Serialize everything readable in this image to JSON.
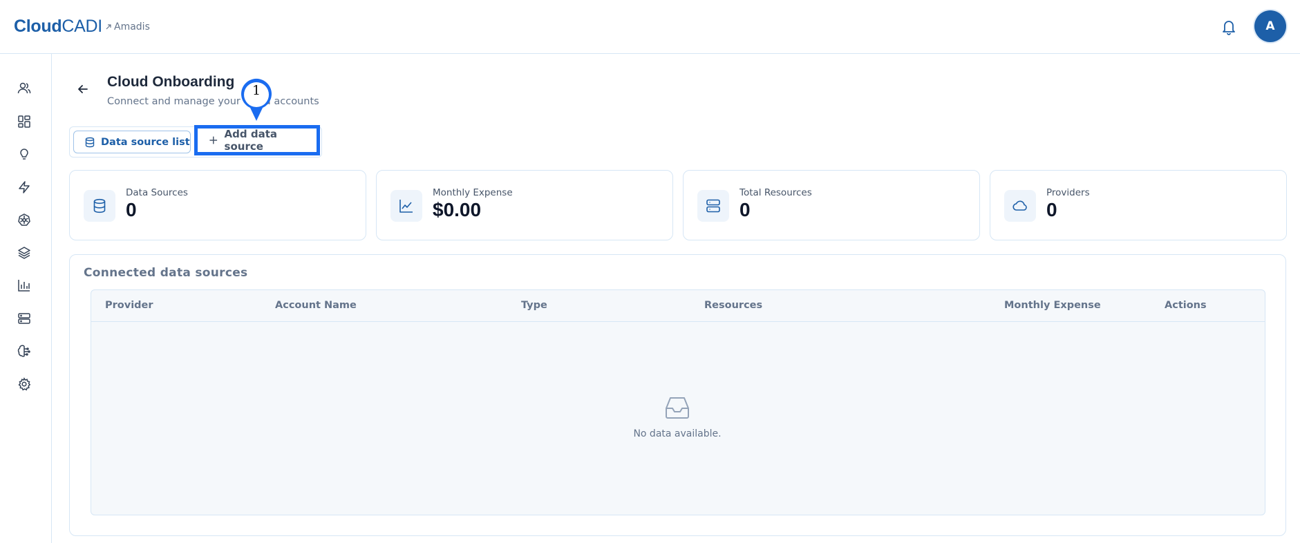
{
  "header": {
    "brand_bold": "Cloud",
    "brand_light": "CADI",
    "org_name": "Amadis",
    "avatar_initial": "A"
  },
  "sidebar": {
    "items": [
      {
        "icon": "users-icon"
      },
      {
        "icon": "dashboard-icon"
      },
      {
        "icon": "lightbulb-icon"
      },
      {
        "icon": "lightning-icon"
      },
      {
        "icon": "kubernetes-icon"
      },
      {
        "icon": "layers-icon"
      },
      {
        "icon": "bar-chart-icon"
      },
      {
        "icon": "server-icon"
      },
      {
        "icon": "brain-icon"
      },
      {
        "icon": "gear-icon"
      }
    ]
  },
  "page": {
    "title": "Cloud Onboarding",
    "subtitle": "Connect and manage your cloud accounts"
  },
  "tabs": {
    "list_label": "Data source list",
    "add_label": "Add data source"
  },
  "marker": {
    "number": "1",
    "color": "#1a6cf0"
  },
  "stats": [
    {
      "label": "Data Sources",
      "value": "0",
      "icon": "database-icon"
    },
    {
      "label": "Monthly Expense",
      "value": "$0.00",
      "icon": "line-chart-icon"
    },
    {
      "label": "Total Resources",
      "value": "0",
      "icon": "server-icon"
    },
    {
      "label": "Providers",
      "value": "0",
      "icon": "cloud-icon"
    }
  ],
  "connected": {
    "title": "Connected data sources",
    "columns": [
      "Provider",
      "Account Name",
      "Type",
      "Resources",
      "Monthly Expense",
      "Actions"
    ],
    "empty_text": "No data available."
  },
  "colors": {
    "brand": "#1d5fa8",
    "border": "#d6e6f5",
    "highlight": "#1a6cf0"
  }
}
